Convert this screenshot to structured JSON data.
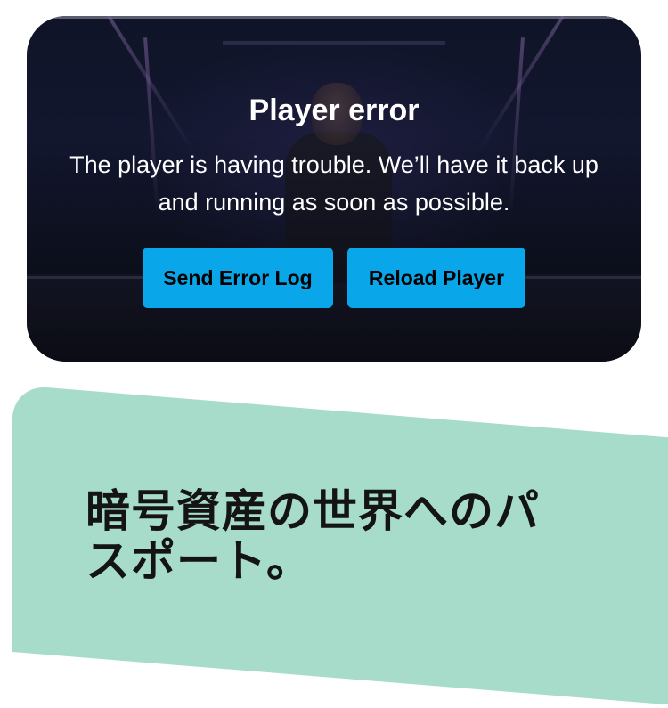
{
  "player": {
    "error_title": "Player error",
    "error_message": "The player is having trouble. We’ll have it back up and running as soon as possible.",
    "send_error_log_label": "Send Error Log",
    "reload_player_label": "Reload Player",
    "button_color": "#0aa6ea"
  },
  "promo": {
    "heading": "暗号資産の世界へのパスポート。",
    "background_color": "#a7dccb"
  }
}
